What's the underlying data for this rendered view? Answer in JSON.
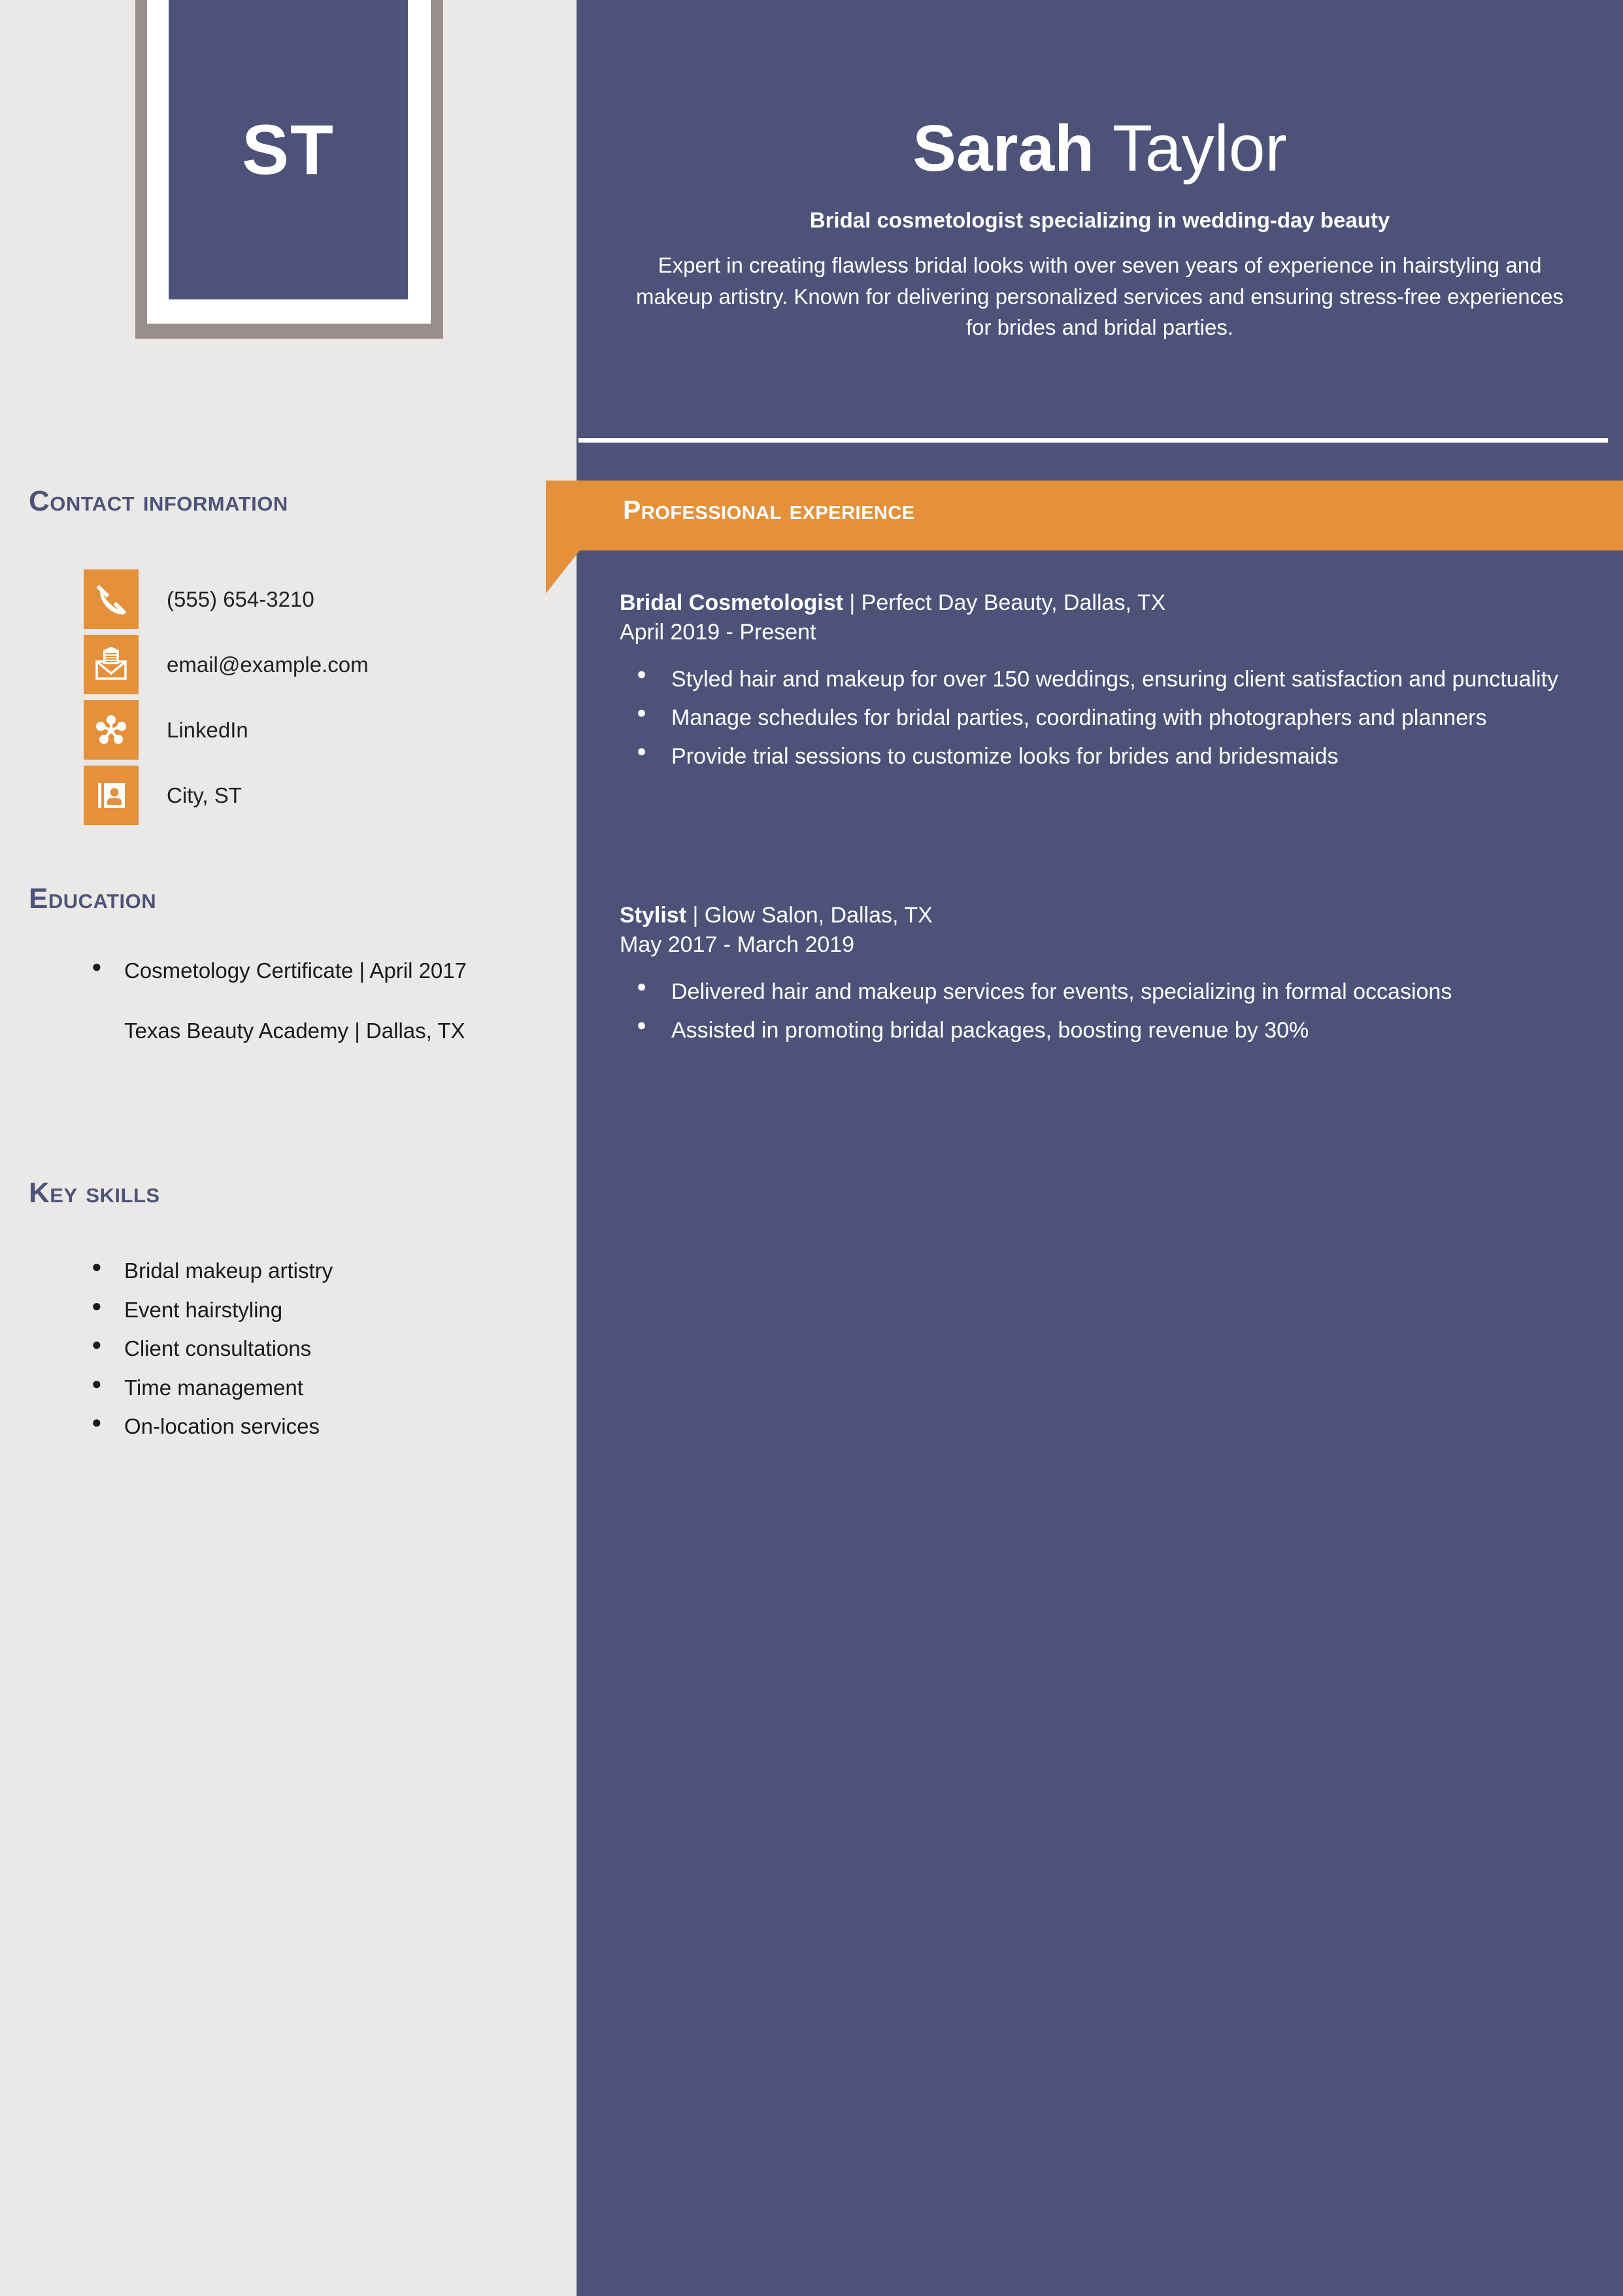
{
  "colors": {
    "panel_blue": "#4d5278",
    "accent_orange": "#e5913c",
    "sidebar_bg": "#eae9e7",
    "monogram_border": "#988e8c",
    "heading_blue": "#4e5379",
    "body_text": "#1a1a1a",
    "white": "#ffffff"
  },
  "header": {
    "monogram": "ST",
    "first_name": "Sarah ",
    "last_name": "Taylor",
    "tagline": "Bridal cosmetologist specializing in wedding-day beauty",
    "summary": "Expert in creating flawless bridal looks with over seven years of experience in hairstyling and makeup artistry. Known for delivering personalized services and ensuring stress-free experiences for brides and bridal parties."
  },
  "sidebar": {
    "contact": {
      "heading": "Contact information",
      "items": [
        {
          "icon": "phone-icon",
          "value": "(555) 654-3210"
        },
        {
          "icon": "email-icon",
          "value": "email@example.com"
        },
        {
          "icon": "linkedin-icon",
          "value": "LinkedIn"
        },
        {
          "icon": "address-card-icon",
          "value": "City, ST"
        }
      ]
    },
    "education": {
      "heading": "Education",
      "items": [
        {
          "text": "Cosmetology Certificate | April 2017",
          "bulleted": true
        },
        {
          "text": "Texas Beauty Academy | Dallas, TX",
          "bulleted": false
        }
      ]
    },
    "skills": {
      "heading": "Key skills",
      "items": [
        "Bridal makeup artistry",
        "Event hairstyling",
        "Client consultations",
        "Time management",
        "On-location services"
      ]
    }
  },
  "experience": {
    "heading": "Professional experience",
    "jobs": [
      {
        "role": "Bridal Cosmetologist",
        "separator": " | ",
        "company": "Perfect Day Beauty, Dallas, TX",
        "dates": "April 2019 - Present",
        "bullets": [
          "Styled hair and makeup for over 150 weddings, ensuring client satisfaction and punctuality",
          "Manage schedules for bridal parties, coordinating with photographers and planners",
          "Provide trial sessions to customize looks for brides and bridesmaids"
        ]
      },
      {
        "role": "Stylist",
        "separator": " | ",
        "company": "Glow Salon, Dallas, TX",
        "dates": "May 2017 - March 2019",
        "bullets": [
          "Delivered hair and makeup services for events, specializing in formal occasions",
          "Assisted in promoting bridal packages, boosting revenue by 30%"
        ]
      }
    ]
  }
}
